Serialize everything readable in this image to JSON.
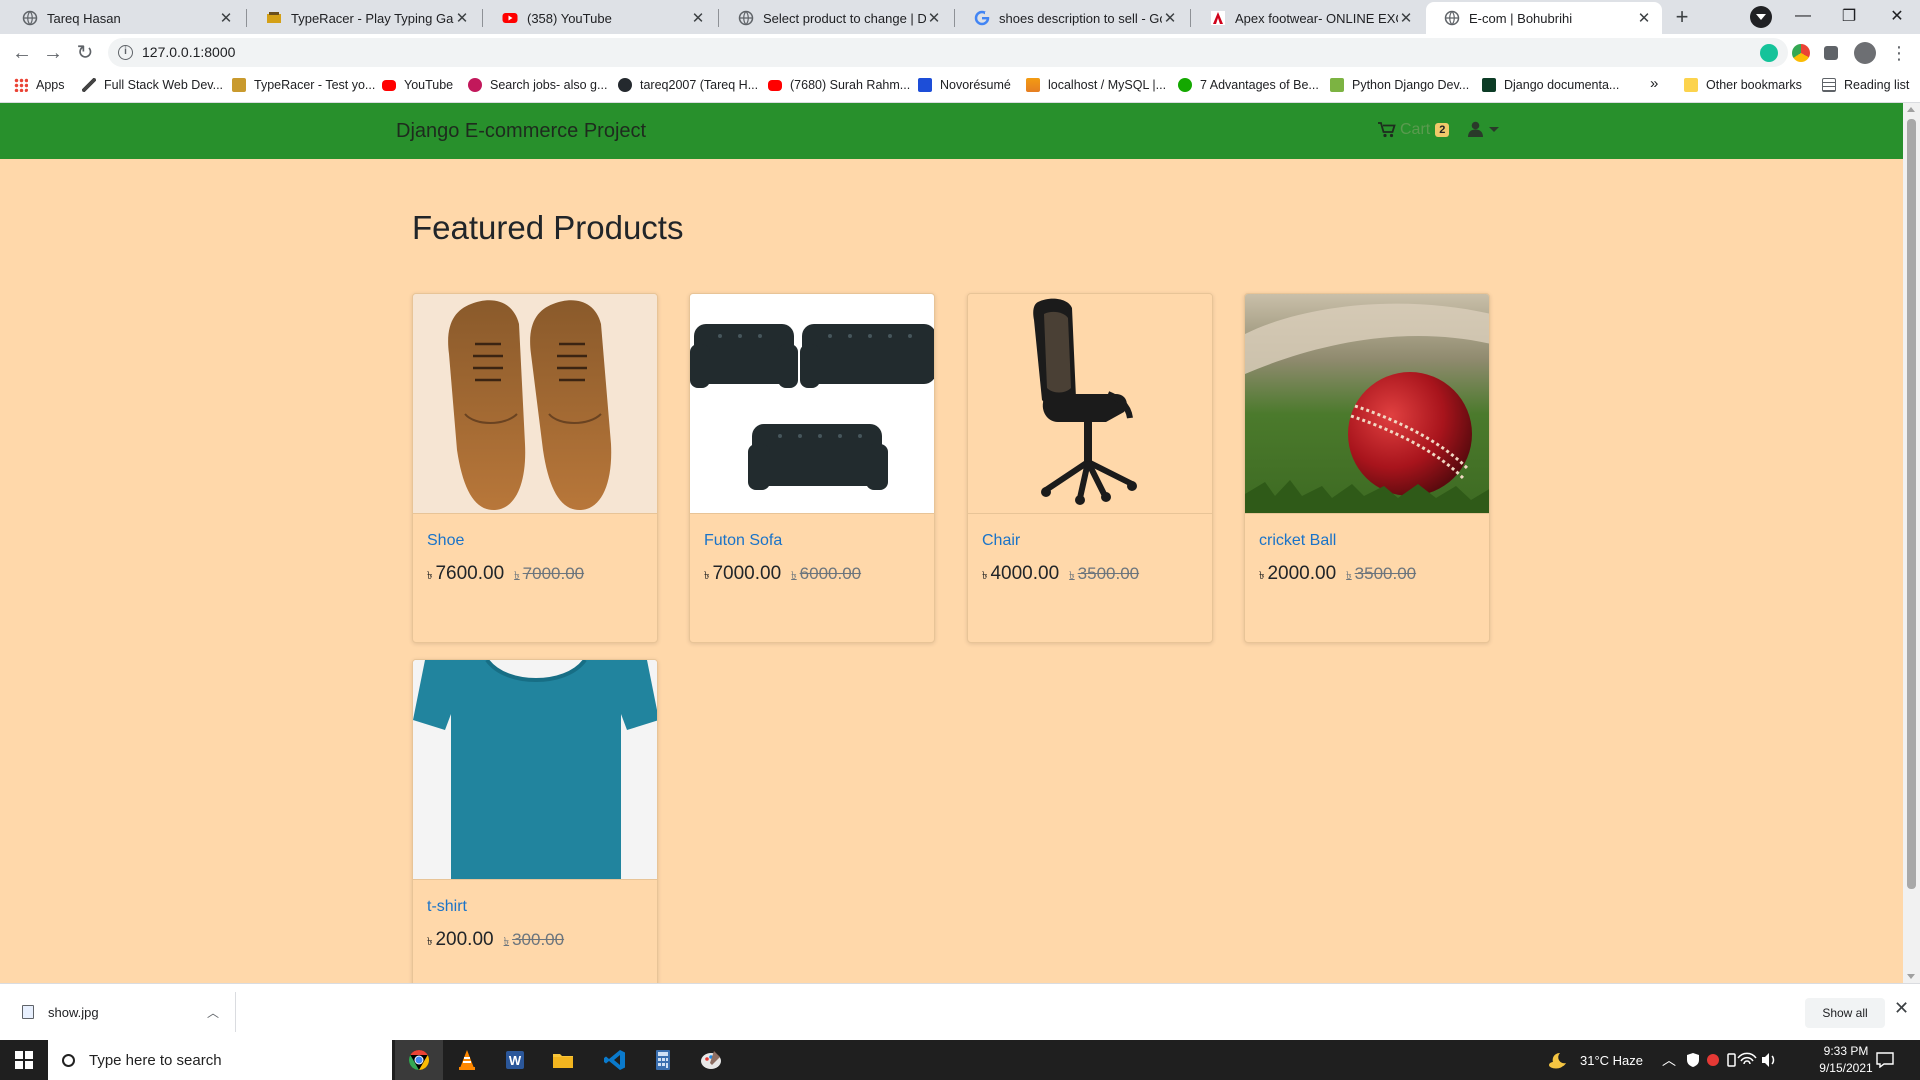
{
  "browser": {
    "tabs": [
      {
        "title": "Tareq Hasan",
        "icon": "globe-icon"
      },
      {
        "title": "TypeRacer - Play Typing Games a",
        "icon": "typeracer-icon"
      },
      {
        "title": "(358) YouTube",
        "icon": "youtube-icon"
      },
      {
        "title": "Select product to change | Djang",
        "icon": "globe-icon"
      },
      {
        "title": "shoes description to sell - Googl",
        "icon": "google-icon"
      },
      {
        "title": "Apex footwear- ONLINE EXCLUSI",
        "icon": "apex-icon"
      },
      {
        "title": "E-com | Bohubrihi",
        "icon": "globe-icon",
        "active": true
      }
    ],
    "new_tab_label": "+",
    "url": "127.0.0.1:8000",
    "bookmarks": [
      {
        "label": "Apps",
        "icon": "apps-grid-icon"
      },
      {
        "label": "Full Stack Web Dev...",
        "icon": "feather-icon"
      },
      {
        "label": "TypeRacer - Test yo...",
        "icon": "typeracer-icon"
      },
      {
        "label": "YouTube",
        "icon": "youtube-icon"
      },
      {
        "label": "Search jobs- also g...",
        "icon": "jobs-icon"
      },
      {
        "label": "tareq2007 (Tareq H...",
        "icon": "github-icon"
      },
      {
        "label": "(7680) Surah Rahm...",
        "icon": "youtube-icon"
      },
      {
        "label": "Novorésumé",
        "icon": "novoresume-icon"
      },
      {
        "label": "localhost / MySQL |...",
        "icon": "phpmyadmin-icon"
      },
      {
        "label": "7 Advantages of Be...",
        "icon": "upwork-icon"
      },
      {
        "label": "Python Django Dev...",
        "icon": "django-dev-icon"
      },
      {
        "label": "Django documenta...",
        "icon": "django-icon"
      }
    ],
    "bookmarks_overflow": "»",
    "other_bookmarks": "Other bookmarks",
    "reading_list": "Reading list"
  },
  "site": {
    "brand": "Django E-commerce Project",
    "cart_label": "Cart",
    "cart_count": "2",
    "heading": "Featured Products",
    "currency_symbol": "৳",
    "products": [
      {
        "name": "Shoe",
        "price": "7600.00",
        "old_price": "7000.00"
      },
      {
        "name": "Futon Sofa",
        "price": "7000.00",
        "old_price": "6000.00"
      },
      {
        "name": "Chair",
        "price": "4000.00",
        "old_price": "3500.00"
      },
      {
        "name": "cricket Ball",
        "price": "2000.00",
        "old_price": "3500.00"
      },
      {
        "name": "t-shirt",
        "price": "200.00",
        "old_price": "300.00"
      }
    ],
    "colors": {
      "navbar": "#28902c",
      "background": "#ffd8aa",
      "link": "#1a73c8"
    }
  },
  "downloads": {
    "file": "show.jpg",
    "show_all": "Show all"
  },
  "taskbar": {
    "search_placeholder": "Type here to search",
    "weather": "31°C  Haze",
    "time": "9:33 PM",
    "date": "9/15/2021"
  }
}
